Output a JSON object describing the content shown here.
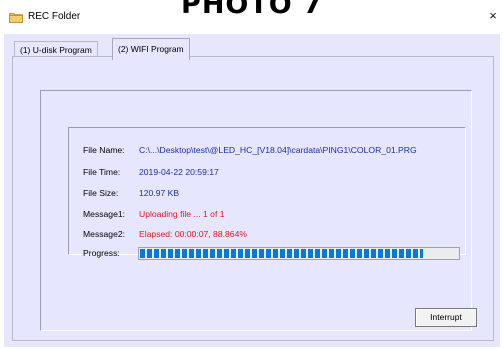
{
  "overlay_caption": "PHOTO 7",
  "window": {
    "title": "REC Folder",
    "close_glyph": "×",
    "icon": "folder-icon"
  },
  "tabs": [
    {
      "label": "(1) U-disk Program",
      "selected": false
    },
    {
      "label": "(2) WIFI Program",
      "selected": true
    }
  ],
  "transfer": {
    "file_name_label": "File Name:",
    "file_name": "C:\\...\\Desktop\\test\\@LED_HC_[V18.04]\\cardata\\PING1\\COLOR_01.PRG",
    "file_time_label": "File Time:",
    "file_time": "2019-04-22 20:59:17",
    "file_size_label": "File Size:",
    "file_size": "120.97 KB",
    "message1_label": "Message1:",
    "message1": "Uploading file ... 1 of 1",
    "message2_label": "Message2:",
    "message2": "Elapsed: 00:00:07,   88.864%",
    "progress_label": "Progress:",
    "progress_fraction": 0.88864
  },
  "buttons": {
    "interrupt_label": "Interrupt"
  },
  "colors": {
    "window_background": "#e6e6ff",
    "value_blue": "#1a2fa8",
    "message_red": "#e0181c",
    "progress_blue": "#0a78d7"
  }
}
